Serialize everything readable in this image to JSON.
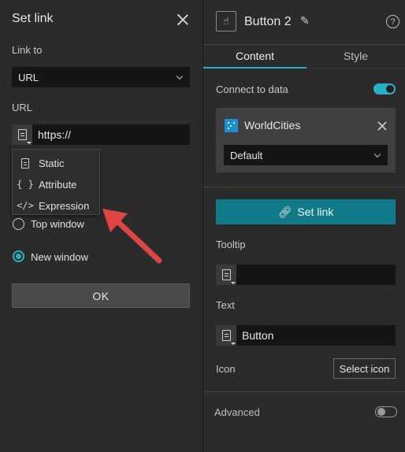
{
  "left": {
    "title": "Set link",
    "link_to_label": "Link to",
    "link_to_value": "URL",
    "url_label": "URL",
    "url_value": "https://",
    "menu": [
      {
        "icon": "document-icon",
        "label": "Static"
      },
      {
        "icon": "braces-icon",
        "glyph": "{ }",
        "label": "Attribute"
      },
      {
        "icon": "code-icon",
        "glyph": "</>",
        "label": "Expression"
      }
    ],
    "radios": [
      {
        "label": "Top window",
        "selected": false
      },
      {
        "label": "New window",
        "selected": true
      }
    ],
    "ok_label": "OK"
  },
  "right": {
    "widget_name": "Button 2",
    "help_glyph": "?",
    "tabs": [
      {
        "label": "Content",
        "active": true
      },
      {
        "label": "Style",
        "active": false
      }
    ],
    "connect_label": "Connect to data",
    "connect_on": true,
    "datasource": {
      "name": "WorldCities",
      "view": "Default"
    },
    "set_link_label": "Set link",
    "tooltip_label": "Tooltip",
    "tooltip_value": "",
    "text_label": "Text",
    "text_value": "Button",
    "icon_label": "Icon",
    "select_icon_label": "Select icon",
    "advanced_label": "Advanced",
    "advanced_on": false
  },
  "colors": {
    "accent": "#2ab0c4",
    "primary_button": "#117a89",
    "arrow": "#e04545",
    "datasource_icon": "#1d8fd1"
  }
}
